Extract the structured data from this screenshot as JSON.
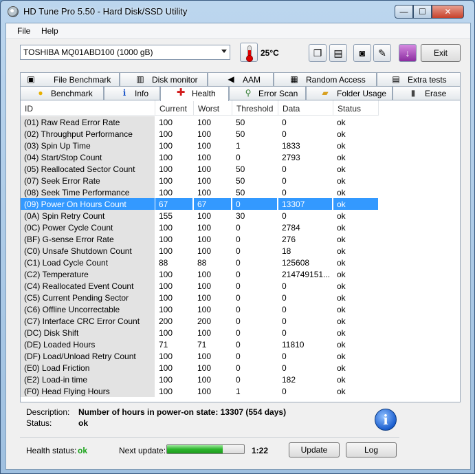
{
  "window": {
    "title": "HD Tune Pro 5.50 - Hard Disk/SSD Utility",
    "controls": {
      "minimize": "—",
      "maximize": "☐",
      "close": "✕"
    }
  },
  "menu": {
    "file": "File",
    "help": "Help"
  },
  "toolbar": {
    "drive": "TOSHIBA MQ01ABD100 (1000 gB)",
    "temperature": "25°C",
    "exit_label": "Exit",
    "icons": [
      "copy-icon",
      "save-icon",
      "camera-icon",
      "options-icon",
      "download-icon"
    ]
  },
  "tabs": {
    "row1": [
      {
        "label": "File Benchmark",
        "icon": "file-benchmark-icon",
        "glyph": "▣"
      },
      {
        "label": "Disk monitor",
        "icon": "disk-monitor-icon",
        "glyph": "▥"
      },
      {
        "label": "AAM",
        "icon": "speaker-icon",
        "glyph": "◀"
      },
      {
        "label": "Random Access",
        "icon": "random-access-icon",
        "glyph": "▦"
      },
      {
        "label": "Extra tests",
        "icon": "extra-tests-icon",
        "glyph": "▤"
      }
    ],
    "row2": [
      {
        "label": "Benchmark",
        "icon": "lightbulb-icon",
        "glyph": "●"
      },
      {
        "label": "Info",
        "icon": "info-icon",
        "glyph": "i"
      },
      {
        "label": "Health",
        "icon": "health-cross-icon",
        "glyph": "✚",
        "active": true
      },
      {
        "label": "Error Scan",
        "icon": "magnifier-icon",
        "glyph": "⚲"
      },
      {
        "label": "Folder Usage",
        "icon": "folder-icon",
        "glyph": "▰"
      },
      {
        "label": "Erase",
        "icon": "trash-icon",
        "glyph": "▮"
      }
    ]
  },
  "table": {
    "columns": [
      "ID",
      "Current",
      "Worst",
      "Threshold",
      "Data",
      "Status"
    ],
    "rows": [
      [
        "(01) Raw Read Error Rate",
        "100",
        "100",
        "50",
        "0",
        "ok"
      ],
      [
        "(02) Throughput Performance",
        "100",
        "100",
        "50",
        "0",
        "ok"
      ],
      [
        "(03) Spin Up Time",
        "100",
        "100",
        "1",
        "1833",
        "ok"
      ],
      [
        "(04) Start/Stop Count",
        "100",
        "100",
        "0",
        "2793",
        "ok"
      ],
      [
        "(05) Reallocated Sector Count",
        "100",
        "100",
        "50",
        "0",
        "ok"
      ],
      [
        "(07) Seek Error Rate",
        "100",
        "100",
        "50",
        "0",
        "ok"
      ],
      [
        "(08) Seek Time Performance",
        "100",
        "100",
        "50",
        "0",
        "ok"
      ],
      [
        "(09) Power On Hours Count",
        "67",
        "67",
        "0",
        "13307",
        "ok"
      ],
      [
        "(0A) Spin Retry Count",
        "155",
        "100",
        "30",
        "0",
        "ok"
      ],
      [
        "(0C) Power Cycle Count",
        "100",
        "100",
        "0",
        "2784",
        "ok"
      ],
      [
        "(BF) G-sense Error Rate",
        "100",
        "100",
        "0",
        "276",
        "ok"
      ],
      [
        "(C0) Unsafe Shutdown Count",
        "100",
        "100",
        "0",
        "18",
        "ok"
      ],
      [
        "(C1) Load Cycle Count",
        "88",
        "88",
        "0",
        "125608",
        "ok"
      ],
      [
        "(C2) Temperature",
        "100",
        "100",
        "0",
        "214749151...",
        "ok"
      ],
      [
        "(C4) Reallocated Event Count",
        "100",
        "100",
        "0",
        "0",
        "ok"
      ],
      [
        "(C5) Current Pending Sector",
        "100",
        "100",
        "0",
        "0",
        "ok"
      ],
      [
        "(C6) Offline Uncorrectable",
        "100",
        "100",
        "0",
        "0",
        "ok"
      ],
      [
        "(C7) Interface CRC Error Count",
        "200",
        "200",
        "0",
        "0",
        "ok"
      ],
      [
        "(DC) Disk Shift",
        "100",
        "100",
        "0",
        "0",
        "ok"
      ],
      [
        "(DE) Loaded Hours",
        "71",
        "71",
        "0",
        "11810",
        "ok"
      ],
      [
        "(DF) Load/Unload Retry Count",
        "100",
        "100",
        "0",
        "0",
        "ok"
      ],
      [
        "(E0) Load Friction",
        "100",
        "100",
        "0",
        "0",
        "ok"
      ],
      [
        "(E2) Load-in time",
        "100",
        "100",
        "0",
        "182",
        "ok"
      ],
      [
        "(F0) Head Flying Hours",
        "100",
        "100",
        "1",
        "0",
        "ok"
      ]
    ],
    "selected_index": 7
  },
  "details": {
    "description_label": "Description:",
    "description_value": "Number of hours in power-on state: 13307 (554 days)",
    "status_label": "Status:",
    "status_value": "ok",
    "info_glyph": "i"
  },
  "footer": {
    "health_label": "Health status:",
    "health_value": "ok",
    "next_update_label": "Next update:",
    "progress_fraction": 0.72,
    "time": "1:22",
    "update_label": "Update",
    "log_label": "Log"
  },
  "colors": {
    "selection": "#3399ff",
    "health_ok": "#1aa31a",
    "progress": "#2db52d"
  }
}
